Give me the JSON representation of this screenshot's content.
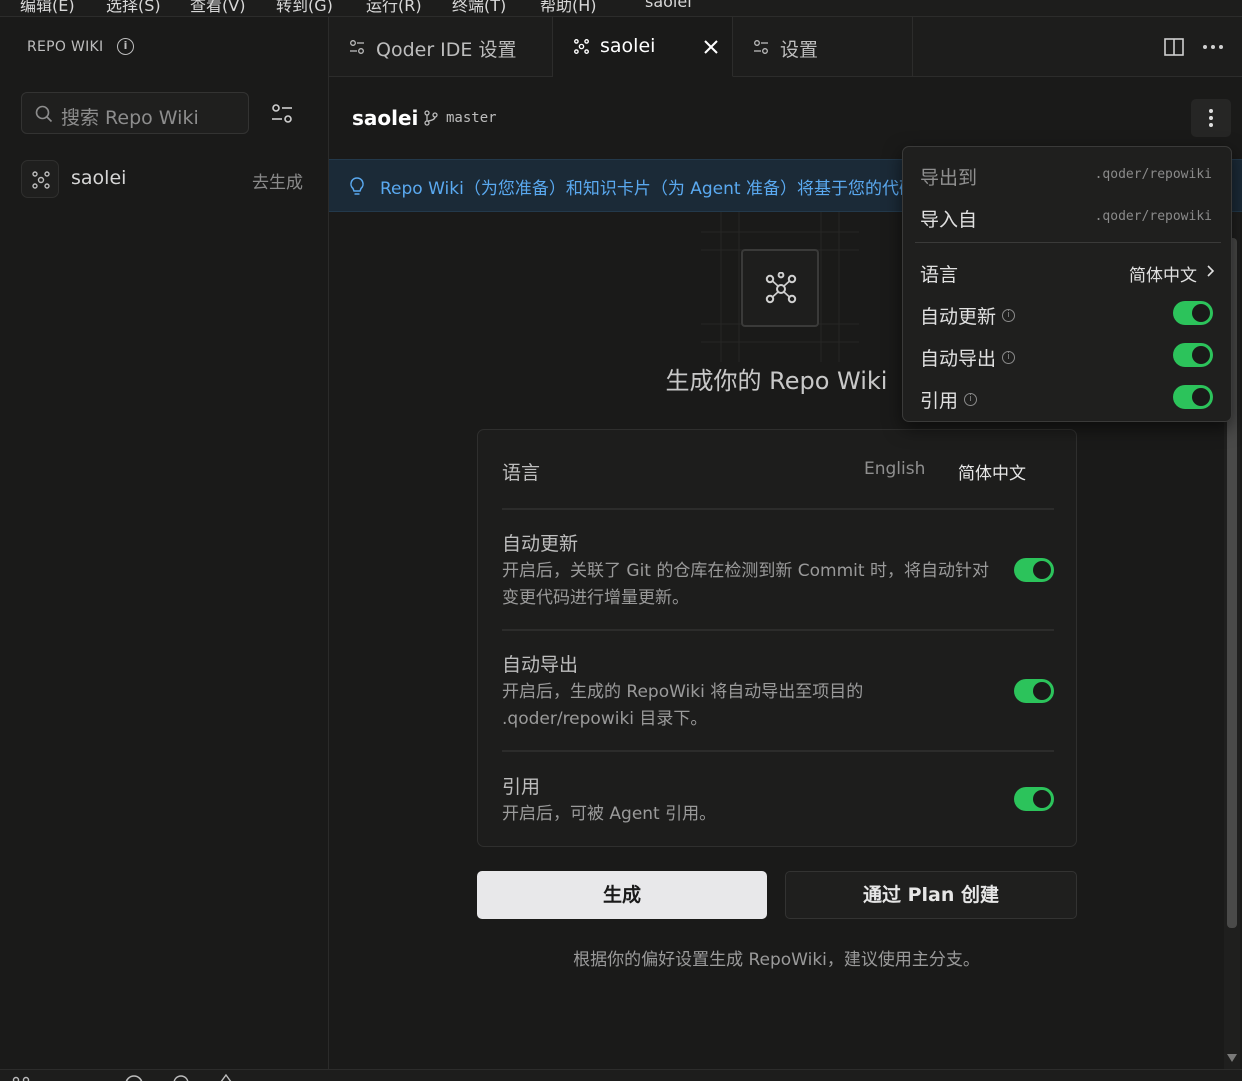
{
  "menubar": {
    "items": [
      "编辑(E)",
      "选择(S)",
      "查看(V)",
      "转到(G)",
      "运行(R)",
      "终端(T)",
      "帮助(H)",
      "saolei"
    ]
  },
  "sidebar": {
    "title": "REPO WIKI",
    "search_placeholder": "搜索 Repo Wiki",
    "repos": [
      {
        "name": "saolei",
        "action": "去生成"
      }
    ]
  },
  "tabs": [
    {
      "label": "Qoder IDE 设置",
      "icon": "settings-sliders-icon",
      "active": false
    },
    {
      "label": "saolei",
      "icon": "wiki-node-icon",
      "active": true
    },
    {
      "label": "设置",
      "icon": "settings-sliders-icon",
      "active": false
    }
  ],
  "header": {
    "repo_name": "saolei",
    "branch": "master"
  },
  "banner": {
    "text": "Repo Wiki（为您准备）和知识卡片（为 Agent 准备）将基于您的代码仓库自动生成"
  },
  "hero": {
    "title": "生成你的 Repo Wiki"
  },
  "settings": {
    "language": {
      "label": "语言",
      "options": [
        "English",
        "简体中文"
      ],
      "selected": "简体中文"
    },
    "auto_update": {
      "label": "自动更新",
      "desc": "开启后，关联了 Git 的仓库在检测到新 Commit 时，将自动针对变更代码进行增量更新。",
      "enabled": true
    },
    "auto_export": {
      "label": "自动导出",
      "desc": "开启后，生成的 RepoWiki 将自动导出至项目的 .qoder/repowiki 目录下。",
      "enabled": true
    },
    "reference": {
      "label": "引用",
      "desc": "开启后，可被 Agent 引用。",
      "enabled": true
    }
  },
  "actions": {
    "generate": "生成",
    "plan_create": "通过 Plan 创建",
    "hint": "根据你的偏好设置生成 RepoWiki，建议使用主分支。"
  },
  "dropdown": {
    "export_to": {
      "label": "导出到",
      "path": ".qoder/repowiki"
    },
    "import_from": {
      "label": "导入自",
      "path": ".qoder/repowiki"
    },
    "language": {
      "label": "语言",
      "value": "简体中文"
    },
    "auto_update": {
      "label": "自动更新",
      "enabled": true
    },
    "auto_export": {
      "label": "自动导出",
      "enabled": true
    },
    "reference": {
      "label": "引用",
      "enabled": true
    }
  },
  "colors": {
    "accent_green": "#2cc35b",
    "banner_blue": "#5aa9f0",
    "background": "#1a1a19"
  }
}
